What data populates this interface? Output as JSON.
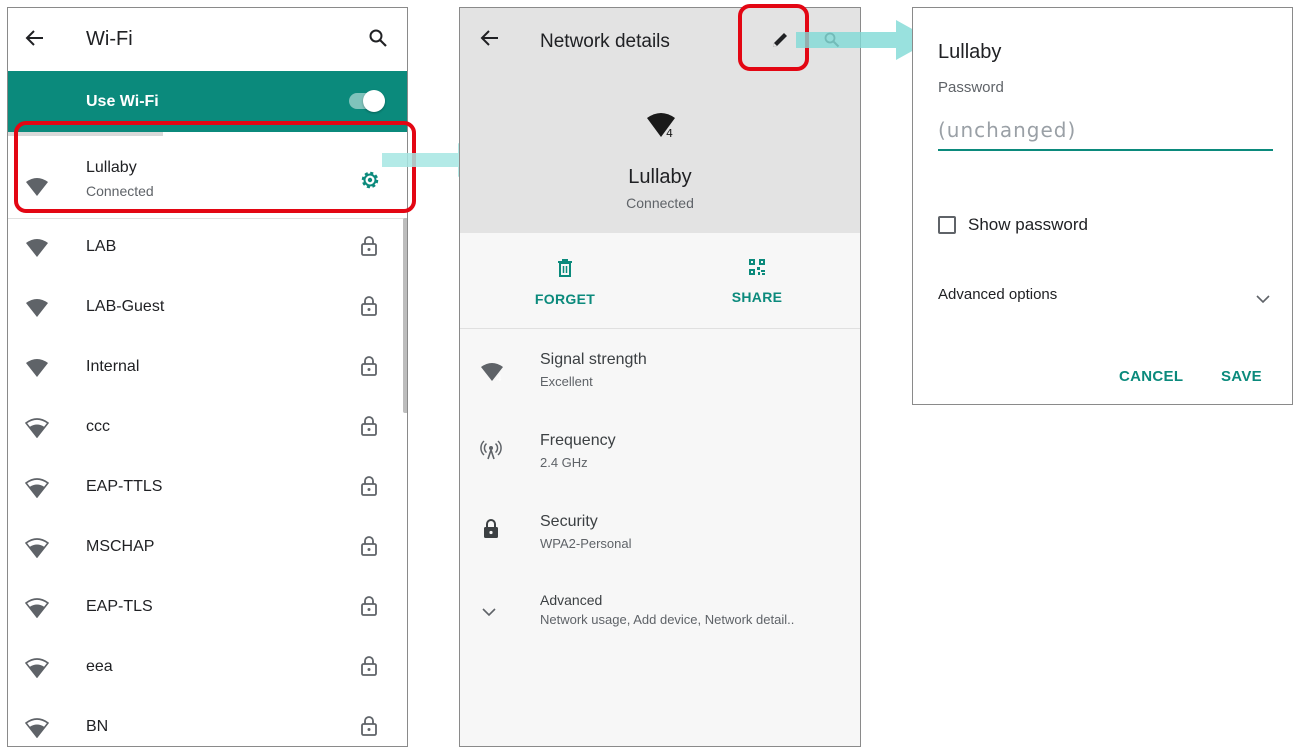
{
  "wifi_list": {
    "title": "Wi-Fi",
    "toggle_label": "Use Wi-Fi",
    "toggle_on": true,
    "connected": {
      "name": "Lullaby",
      "status": "Connected"
    },
    "networks": [
      {
        "name": "LAB",
        "signal": "full"
      },
      {
        "name": "LAB-Guest",
        "signal": "full"
      },
      {
        "name": "Internal",
        "signal": "full"
      },
      {
        "name": "ccc",
        "signal": "high"
      },
      {
        "name": "EAP-TTLS",
        "signal": "high"
      },
      {
        "name": "MSCHAP",
        "signal": "high"
      },
      {
        "name": "EAP-TLS",
        "signal": "high"
      },
      {
        "name": "eea",
        "signal": "high"
      },
      {
        "name": "BN",
        "signal": "high"
      }
    ]
  },
  "details": {
    "title": "Network details",
    "network_name": "Lullaby",
    "status": "Connected",
    "forget_label": "FORGET",
    "share_label": "SHARE",
    "signal_title": "Signal strength",
    "signal_value": "Excellent",
    "freq_title": "Frequency",
    "freq_value": "2.4 GHz",
    "security_title": "Security",
    "security_value": "WPA2-Personal",
    "advanced_title": "Advanced",
    "advanced_value": "Network usage, Add device, Network detail.."
  },
  "dialog": {
    "title": "Lullaby",
    "password_label": "Password",
    "password_placeholder": "(unchanged)",
    "show_password_label": "Show password",
    "advanced_label": "Advanced options",
    "cancel_label": "CANCEL",
    "save_label": "SAVE"
  },
  "colors": {
    "accent": "#0b8a7c",
    "highlight": "#e30613",
    "arrow": "#7fdad6"
  }
}
